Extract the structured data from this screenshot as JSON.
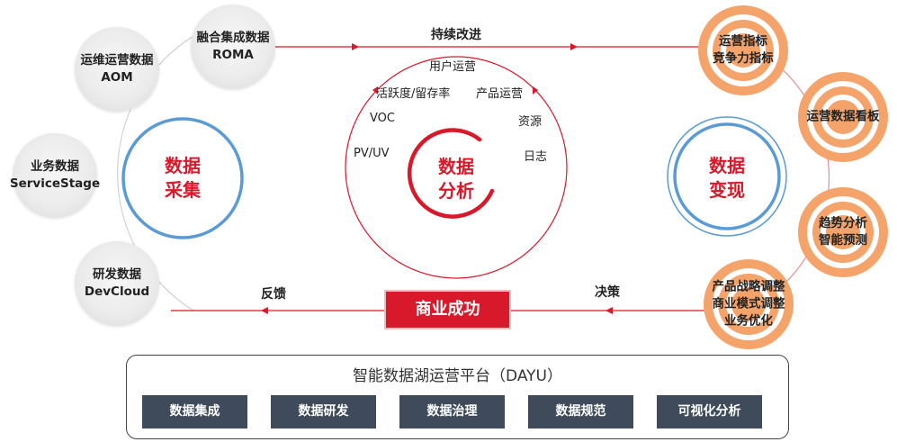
{
  "sources": [
    {
      "name": "融合集成数据",
      "sub": "ROMA"
    },
    {
      "name": "运维运营数据",
      "sub": "AOM"
    },
    {
      "name": "业务数据",
      "sub": "ServiceStage"
    },
    {
      "name": "研发数据",
      "sub": "DevCloud"
    }
  ],
  "collect": {
    "line1": "数据",
    "line2": "采集"
  },
  "analyze": {
    "line1": "数据",
    "line2": "分析",
    "metrics": [
      "用户运营",
      "活跃度/留存率",
      "产品运营",
      "VOC",
      "资源",
      "PV/UV",
      "日志"
    ]
  },
  "monetize": {
    "line1": "数据",
    "line2": "变现"
  },
  "outputs": [
    {
      "lines": [
        "运营指标",
        "竞争力指标"
      ]
    },
    {
      "lines": [
        "运营数据看板"
      ]
    },
    {
      "lines": [
        "趋势分析",
        "智能预测"
      ]
    },
    {
      "lines": [
        "产品战略调整",
        "商业模式调整",
        "业务优化"
      ]
    }
  ],
  "flows": {
    "improve": "持续改进",
    "decide": "决策",
    "feedback": "反馈"
  },
  "success": "商业成功",
  "platform": {
    "title": "智能数据湖运营平台（DAYU）",
    "capabilities": [
      "数据集成",
      "数据研发",
      "数据治理",
      "数据规范",
      "可视化分析"
    ]
  },
  "colors": {
    "red": "#d7192b",
    "blue": "#5b9bd5",
    "orange": "#f4a46b",
    "dark": "#3f4b5b"
  }
}
